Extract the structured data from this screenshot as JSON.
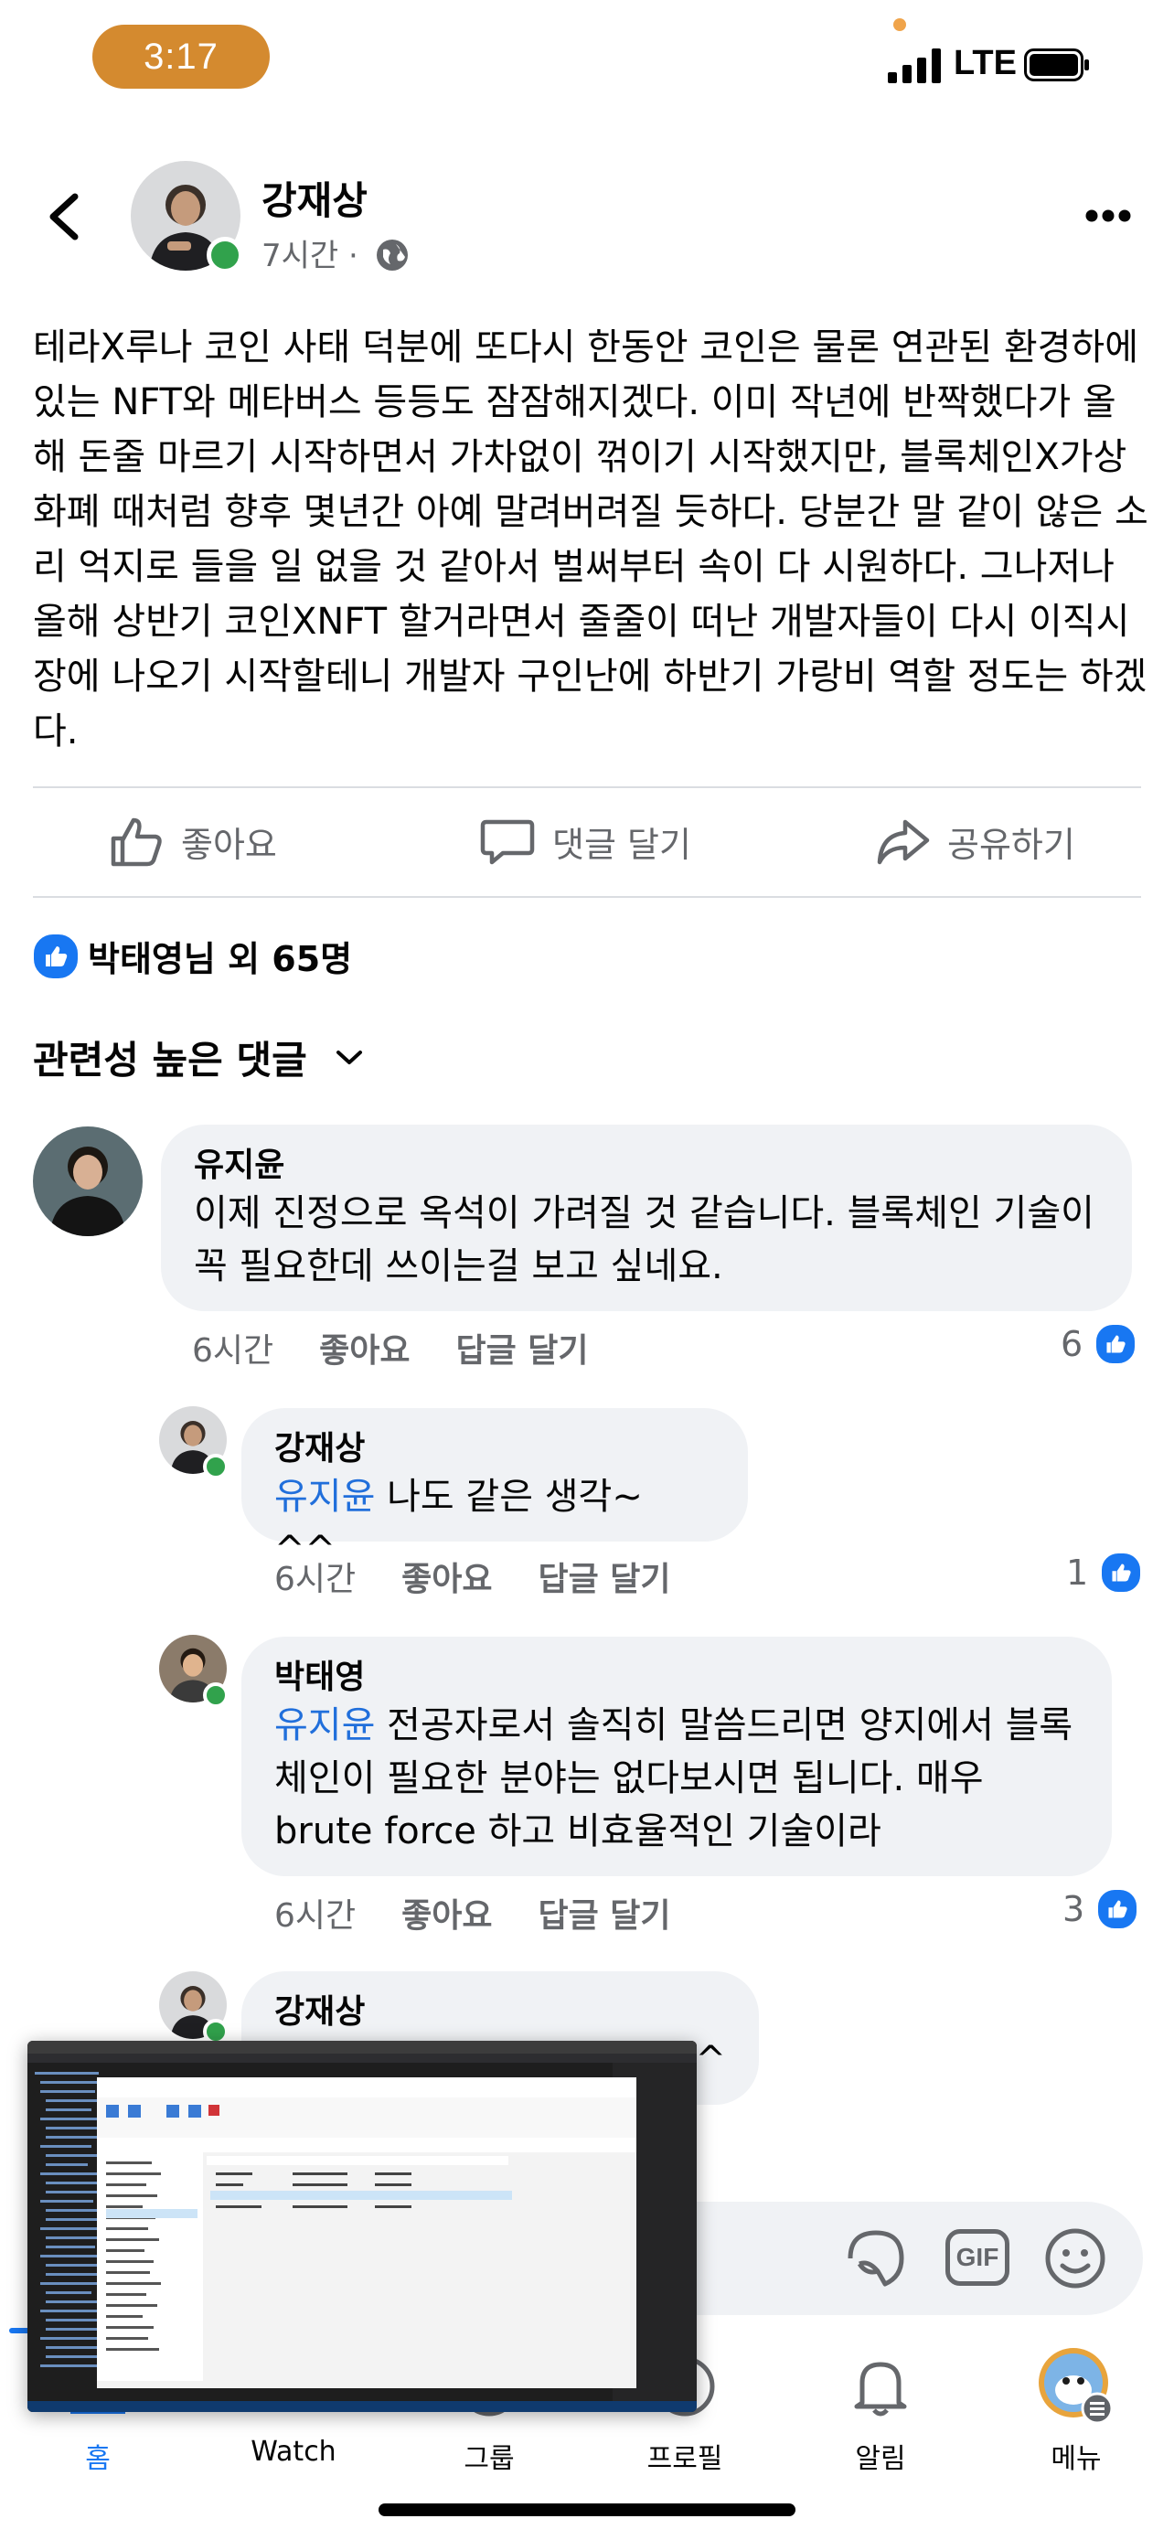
{
  "status_bar": {
    "time": "3:17",
    "network": "LTE"
  },
  "post": {
    "author": "강재상",
    "time": "7시간 ·",
    "text": "테라X루나 코인 사태 덕분에 또다시 한동안 코인은 물론 연관된 환경하에 있는 NFT와 메타버스 등등도 잠잠해지겠다. 이미 작년에 반짝했다가 올해 돈줄 마르기 시작하면서 가차없이 꺾이기 시작했지만, 블록체인X가상화폐 때처럼 향후 몇년간 아예 말려버려질 듯하다. 당분간 말 같이 않은 소리 억지로 들을 일 없을 것 같아서 벌써부터 속이 다 시원하다. 그나저나 올해 상반기 코인XNFT 할거라면서 줄줄이 떠난 개발자들이 다시 이직시장에 나오기 시작할테니 개발자 구인난에 하반기 가랑비 역할 정도는 하겠다."
  },
  "actions": {
    "like": "좋아요",
    "comment": "댓글 달기",
    "share": "공유하기"
  },
  "reactions": {
    "summary": "박태영님 외 65명"
  },
  "comments_header": "관련성 높은 댓글",
  "comments": [
    {
      "name": "유지윤",
      "mention": "",
      "text": "이제 진정으로 옥석이 가려질 것 같습니다. 블록체인 기술이 꼭 필요한데 쓰이는걸 보고 싶네요.",
      "time": "6시간",
      "like": "좋아요",
      "reply": "답글 달기",
      "count": "6"
    },
    {
      "name": "강재상",
      "mention": "유지윤",
      "text": " 나도 같은 생각~ ^^",
      "time": "6시간",
      "like": "좋아요",
      "reply": "답글 달기",
      "count": "1"
    },
    {
      "name": "박태영",
      "mention": "유지윤",
      "text": " 전공자로서 솔직히 말씀드리면 양지에서 블록체인이 필요한 분야는 없다보시면 됩니다. 매우 brute force 하고 비효율적인 기술이라",
      "time": "6시간",
      "like": "좋아요",
      "reply": "답글 달기",
      "count": "3"
    },
    {
      "name": "강재상",
      "mention": "",
      "text": "^"
    }
  ],
  "input_bar": {
    "gif": "GIF"
  },
  "nav": {
    "items": [
      {
        "label": "홈",
        "icon": "home-icon",
        "active": true
      },
      {
        "label": "Watch",
        "icon": "watch-icon"
      },
      {
        "label": "그룹",
        "icon": "groups-icon"
      },
      {
        "label": "프로필",
        "icon": "profile-icon"
      },
      {
        "label": "알림",
        "icon": "bell-icon"
      },
      {
        "label": "메뉴",
        "icon": "menu-avatar-icon"
      }
    ]
  },
  "colors": {
    "accent": "#1877f2",
    "online": "#31a24c",
    "time_pill": "#d48a2f",
    "bubble": "#f0f2f5"
  }
}
